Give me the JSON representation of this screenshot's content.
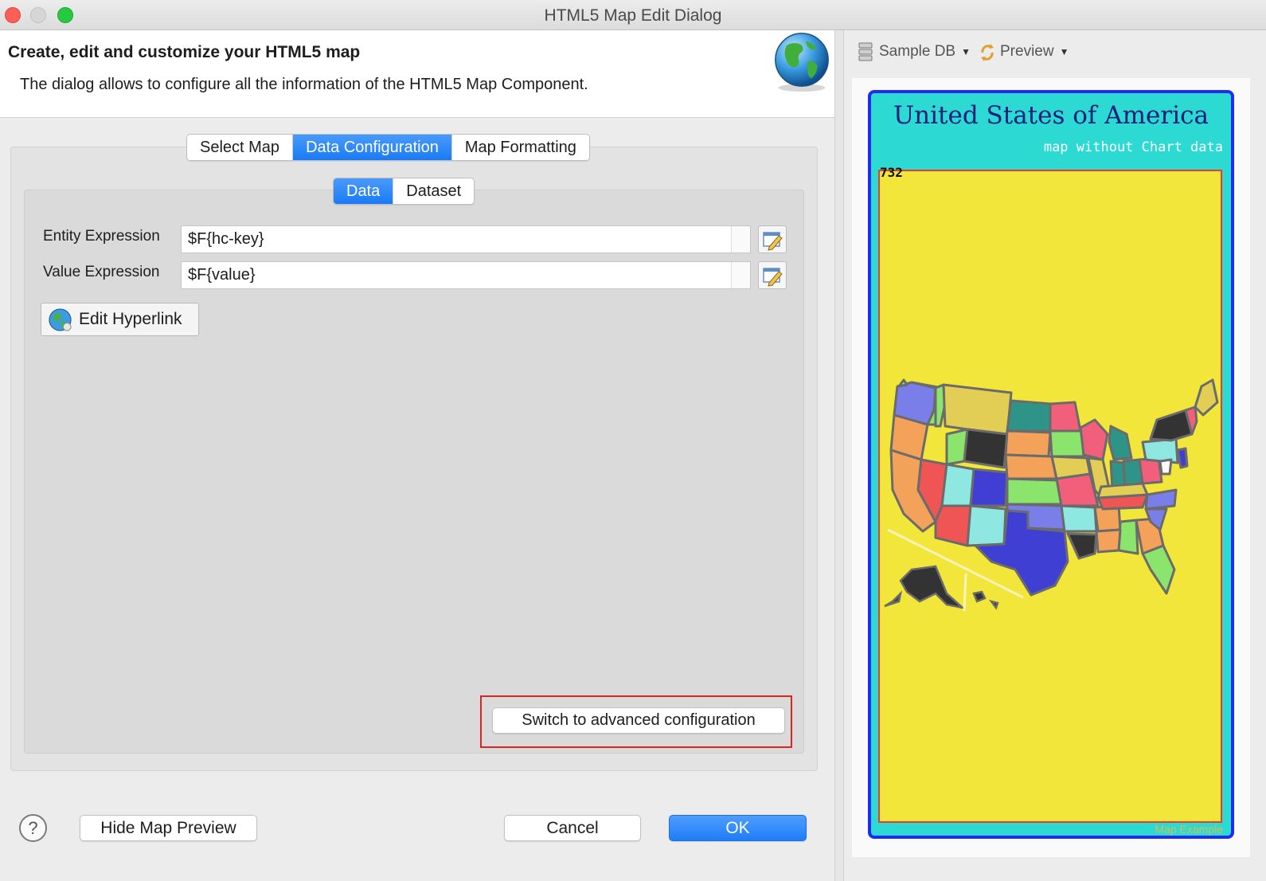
{
  "window": {
    "title": "HTML5 Map Edit Dialog"
  },
  "header": {
    "title": "Create, edit and customize your HTML5 map",
    "description": "The dialog allows to configure all the information of the HTML5 Map Component.",
    "logo_icon": "globe-icon"
  },
  "tabs": [
    {
      "label": "Select Map",
      "active": false
    },
    {
      "label": "Data Configuration",
      "active": true
    },
    {
      "label": "Map Formatting",
      "active": false
    }
  ],
  "subtabs": [
    {
      "label": "Data",
      "active": true
    },
    {
      "label": "Dataset",
      "active": false
    }
  ],
  "form": {
    "entity_label": "Entity Expression",
    "entity_value": "$F{hc-key}",
    "value_label": "Value Expression",
    "value_value": "$F{value}",
    "expression_editor_icon": "expression-editor-icon",
    "hyperlink_button": "Edit Hyperlink",
    "advanced_button": "Switch to advanced configuration"
  },
  "footer": {
    "help": "?",
    "hide_preview": "Hide Map Preview",
    "cancel": "Cancel",
    "ok": "OK"
  },
  "preview": {
    "data_adapter": "Sample DB",
    "preview_menu": "Preview",
    "map_title": "United States of America",
    "map_subtitle": "map without Chart data",
    "map_number": "732",
    "map_credit": "Map Example"
  },
  "colors": {
    "accent": "#1f7df7",
    "highlight": "#e4231e",
    "map_frame_bg": "#2cd9d3",
    "map_frame_border": "#1c2cf0",
    "map_plot_bg": "#f3e63a"
  }
}
